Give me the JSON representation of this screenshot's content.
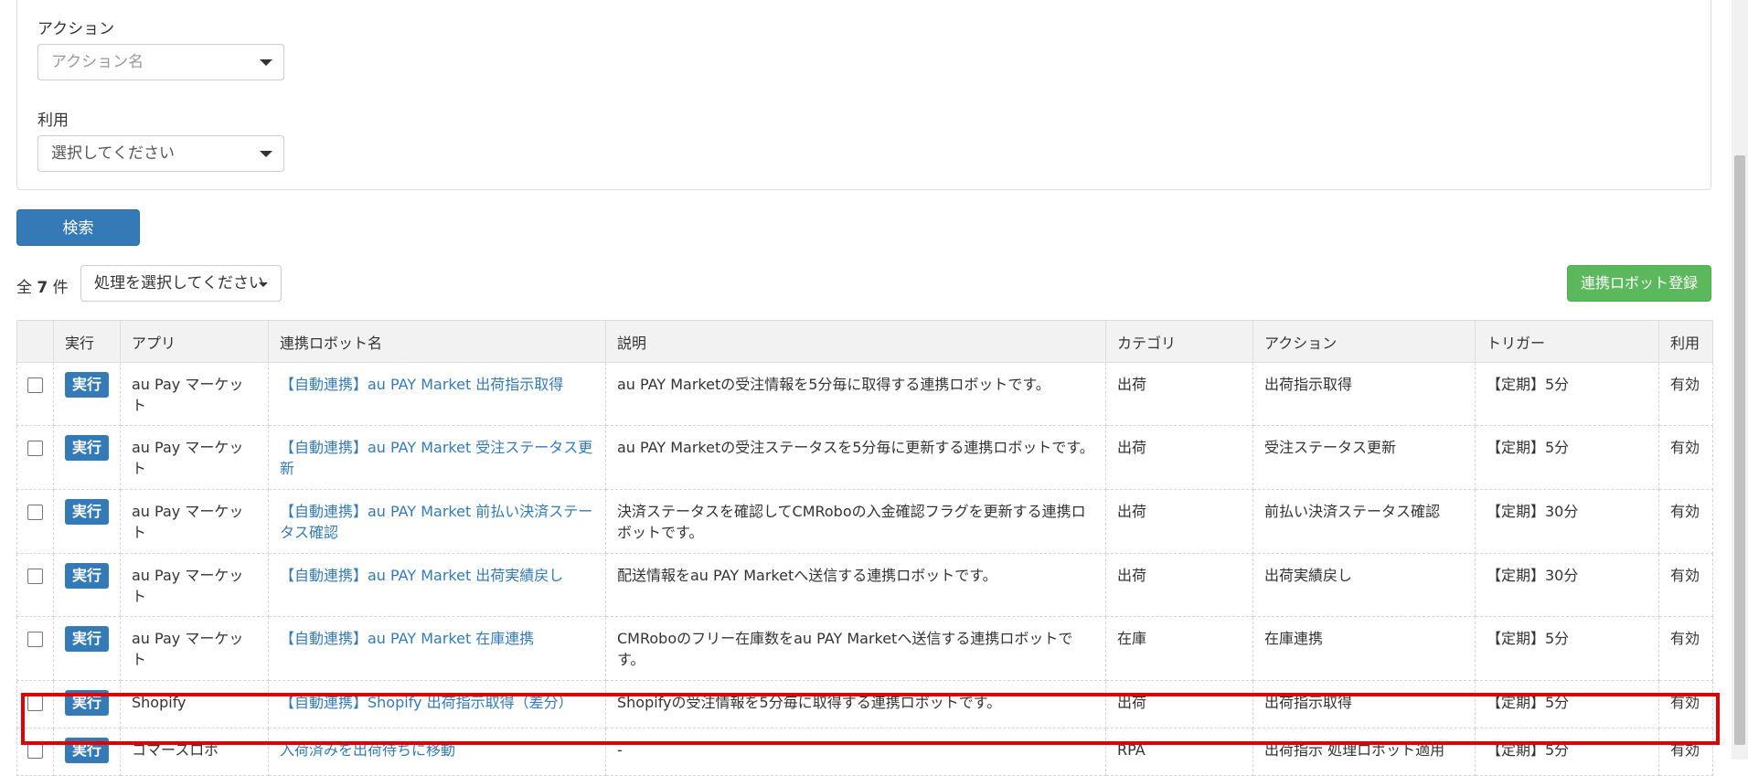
{
  "filters": {
    "action_label": "アクション",
    "action_placeholder": "アクション名",
    "usage_label": "利用",
    "usage_value": "選択してください"
  },
  "search_button": "検索",
  "summary": {
    "total_prefix": "全",
    "total_count": "7",
    "total_suffix": "件",
    "bulk_action": "処理を選択してください"
  },
  "register_button": "連携ロボット登録",
  "table": {
    "headers": [
      "",
      "実行",
      "アプリ",
      "連携ロボット名",
      "説明",
      "カテゴリ",
      "アクション",
      "トリガー",
      "利用"
    ],
    "run_label": "実行",
    "rows": [
      {
        "app": "au Pay マーケット",
        "name": "【自動連携】au PAY Market 出荷指示取得",
        "desc": "au PAY Marketの受注情報を5分毎に取得する連携ロボットです。",
        "category": "出荷",
        "action": "出荷指示取得",
        "trigger": "【定期】5分",
        "usage": "有効"
      },
      {
        "app": "au Pay マーケット",
        "name": "【自動連携】au PAY Market 受注ステータス更新",
        "desc": "au PAY Marketの受注ステータスを5分毎に更新する連携ロボットです。",
        "category": "出荷",
        "action": "受注ステータス更新",
        "trigger": "【定期】5分",
        "usage": "有効"
      },
      {
        "app": "au Pay マーケット",
        "name": "【自動連携】au PAY Market 前払い決済ステータス確認",
        "desc": "決済ステータスを確認してCMRoboの入金確認フラグを更新する連携ロボットです。",
        "category": "出荷",
        "action": "前払い決済ステータス確認",
        "trigger": "【定期】30分",
        "usage": "有効"
      },
      {
        "app": "au Pay マーケット",
        "name": "【自動連携】au PAY Market 出荷実績戻し",
        "desc": "配送情報をau PAY Marketへ送信する連携ロボットです。",
        "category": "出荷",
        "action": "出荷実績戻し",
        "trigger": "【定期】30分",
        "usage": "有効"
      },
      {
        "app": "au Pay マーケット",
        "name": "【自動連携】au PAY Market 在庫連携",
        "desc": "CMRoboのフリー在庫数をau PAY Marketへ送信する連携ロボットです。",
        "category": "在庫",
        "action": "在庫連携",
        "trigger": "【定期】5分",
        "usage": "有効"
      },
      {
        "app": "Shopify",
        "name": "【自動連携】Shopify 出荷指示取得（差分）",
        "desc": "Shopifyの受注情報を5分毎に取得する連携ロボットです。",
        "category": "出荷",
        "action": "出荷指示取得",
        "trigger": "【定期】5分",
        "usage": "有効"
      },
      {
        "app": "コマースロボ",
        "name": "入荷済みを出荷待ちに移動",
        "desc": "-",
        "category": "RPA",
        "action": "出荷指示 処理ロボット適用",
        "trigger": "【定期】5分",
        "usage": "有効"
      }
    ]
  },
  "colors": {
    "primary": "#337ab7",
    "success": "#5cb85c",
    "highlight": "#e00000"
  }
}
